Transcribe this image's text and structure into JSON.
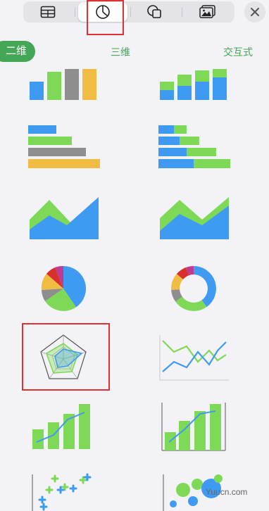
{
  "toolbar": {
    "items": [
      {
        "icon": "table-icon"
      },
      {
        "icon": "chart-icon",
        "selected": true
      },
      {
        "icon": "shapes-icon"
      },
      {
        "icon": "media-icon"
      }
    ],
    "close_icon": "close-icon"
  },
  "segments": {
    "two_d": "二维",
    "three_d": "三维",
    "interactive": "交互式"
  },
  "chart_types": [
    "column-chart",
    "stacked-column-chart",
    "bar-chart",
    "stacked-bar-chart",
    "area-chart",
    "stacked-area-chart",
    "pie-chart",
    "donut-chart",
    "radar-chart",
    "line-chart",
    "mixed-chart",
    "two-axis-chart",
    "scatter-chart",
    "bubble-chart"
  ],
  "watermark": "Yuucn.com",
  "colors": {
    "blue": "#3f9bf2",
    "green": "#7ed957",
    "gray": "#8e8e8e",
    "yellow": "#f0bc42",
    "red": "#d8302f",
    "accent": "#44a755",
    "highlight": "#e03131"
  }
}
